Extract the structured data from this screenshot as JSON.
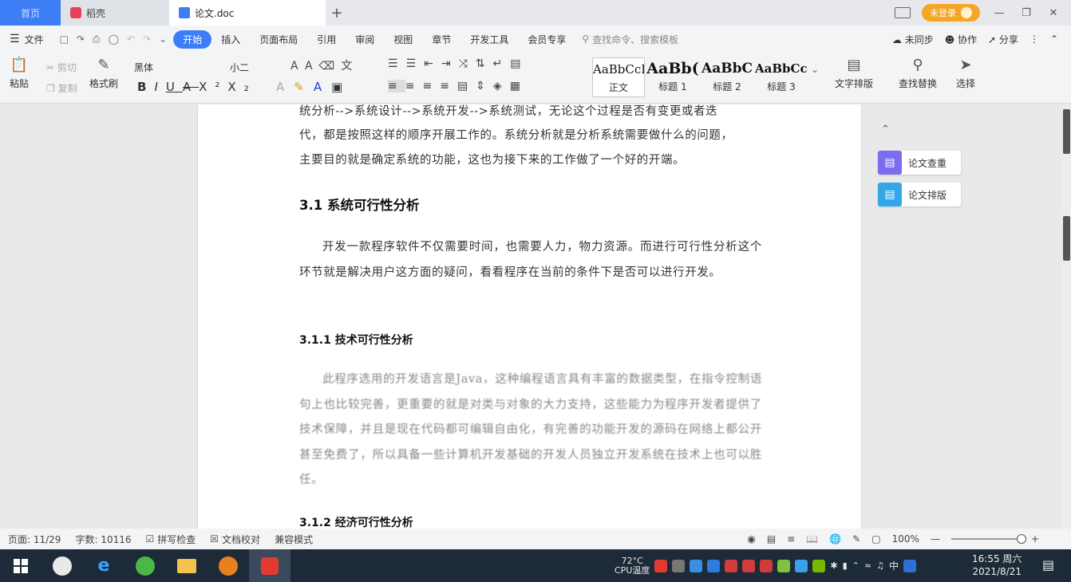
{
  "tabs": {
    "home": "首页",
    "docer": "稻壳",
    "doc": "论文.doc",
    "add": "+"
  },
  "titlebar": {
    "login": "未登录"
  },
  "menu": {
    "file": "文件",
    "items": [
      "开始",
      "插入",
      "页面布局",
      "引用",
      "审阅",
      "视图",
      "章节",
      "开发工具",
      "会员专享"
    ],
    "search_placeholder": "查找命令、搜索模板",
    "sync": "未同步",
    "collab": "协作",
    "share": "分享"
  },
  "ribbon": {
    "paste": "粘贴",
    "cut": "剪切",
    "copy": "复制",
    "format_painter": "格式刷",
    "font_name": "黑体",
    "font_size": "小二",
    "styles": [
      {
        "sample": "AaBbCcI",
        "label": "正文"
      },
      {
        "sample": "AaBb(",
        "label": "标题 1"
      },
      {
        "sample": "AaBbC",
        "label": "标题 2"
      },
      {
        "sample": "AaBbCcI",
        "label": "标题 3"
      }
    ],
    "text_layout": "文字排版",
    "find_replace": "查找替换",
    "select": "选择"
  },
  "document": {
    "para0_line1": "统分析-->系统设计-->系统开发-->系统测试，无论这个过程是否有变更或者迭",
    "para0_line2": "代，都是按照这样的顺序开展工作的。系统分析就是分析系统需要做什么的问题，",
    "para0_line3": "主要目的就是确定系统的功能，这也为接下来的工作做了一个好的开端。",
    "h_3_1": "3.1  系统可行性分析",
    "para1": "开发一款程序软件不仅需要时间，也需要人力，物力资源。而进行可行性分析这个环节就是解决用户这方面的疑问，看看程序在当前的条件下是否可以进行开发。",
    "h_3_1_1": "3.1.1  技术可行性分析",
    "para2": "此程序选用的开发语言是Java，这种编程语言具有丰富的数据类型，在指令控制语句上也比较完善，更重要的就是对类与对象的大力支持，这些能力为程序开发者提供了技术保障，并且是现在代码都可编辑自由化，有完善的功能开发的源码在网络上都公开甚至免费了，所以具备一些计算机开发基础的开发人员独立开发系统在技术上也可以胜任。",
    "h_3_1_2": "3.1.2  经济可行性分析"
  },
  "side_panel": {
    "check": "论文查重",
    "layout": "论文排版"
  },
  "status": {
    "page": "页面: 11/29",
    "words": "字数: 10116",
    "spell": "拼写检查",
    "proof": "文档校对",
    "compat": "兼容模式",
    "zoom": "100%"
  },
  "taskbar": {
    "temp": "72°C",
    "cpu": "CPU温度",
    "ime": "中",
    "time": "16:55 周六",
    "date": "2021/8/21"
  },
  "colors": {
    "accent": "#3d7ef7",
    "taskbar": "#1d2a38",
    "login": "#f5a623"
  }
}
